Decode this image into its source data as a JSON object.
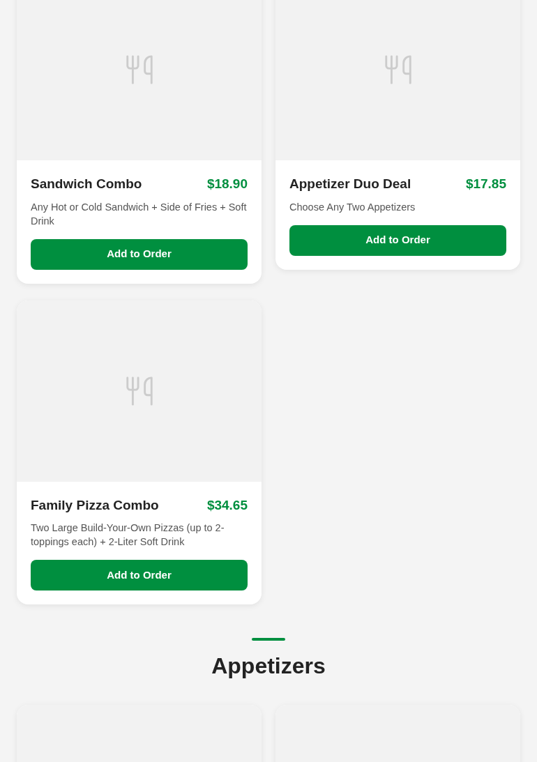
{
  "sections": [
    {
      "items": [
        {
          "kind": "deal",
          "name": "Sandwich Combo",
          "price": "$18.90",
          "description": "Any Hot or Cold Sandwich + Side of Fries + Soft Drink",
          "button": "Add to Order"
        },
        {
          "kind": "deal",
          "name": "Appetizer Duo Deal",
          "price": "$17.85",
          "description": "Choose Any Two Appetizers",
          "button": "Add to Order"
        },
        {
          "kind": "deal",
          "name": "Family Pizza Combo",
          "price": "$34.65",
          "description": "Two Large Build-Your-Own Pizzas (up to 2-toppings each) + 2-Liter Soft Drink",
          "button": "Add to Order"
        }
      ]
    },
    {
      "heading": "Appetizers",
      "items": [
        {
          "kind": "image_only"
        },
        {
          "kind": "image_only"
        }
      ]
    }
  ]
}
